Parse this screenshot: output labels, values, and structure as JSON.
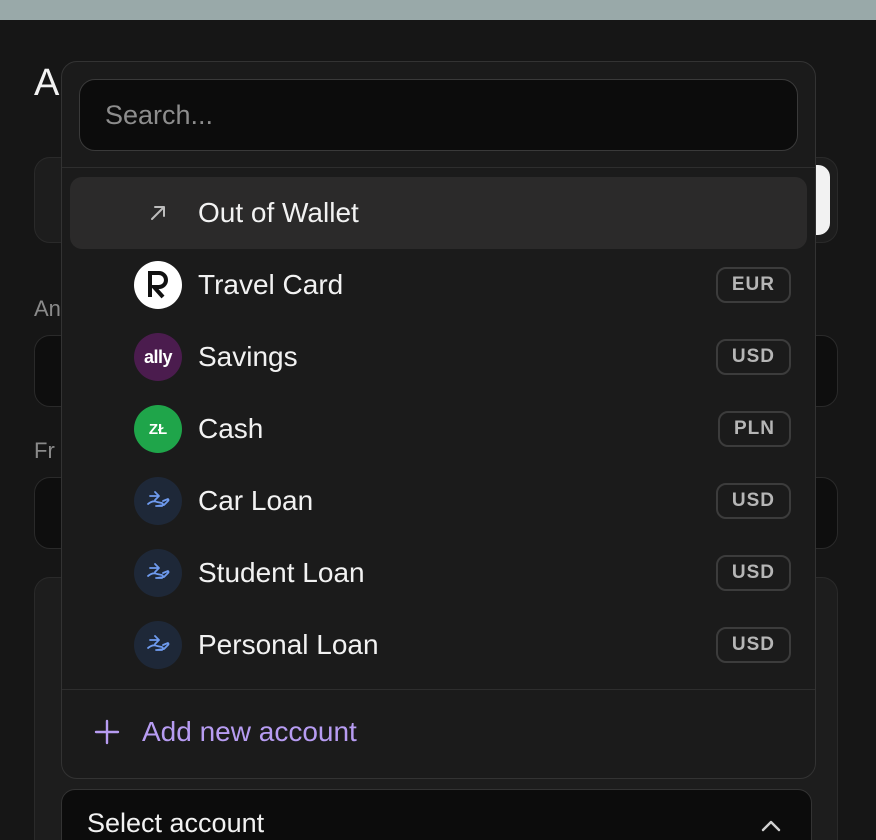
{
  "background": {
    "title_visible": "A",
    "label_1": "An",
    "label_2": "Fr"
  },
  "dropdown": {
    "search_placeholder": "Search...",
    "items": [
      {
        "label": "Out of Wallet",
        "currency": "",
        "icon": "arrow-up-right-icon",
        "active": true
      },
      {
        "label": "Travel Card",
        "currency": "EUR",
        "icon": "revolut-logo-icon"
      },
      {
        "label": "Savings",
        "currency": "USD",
        "icon": "ally-logo-icon",
        "icon_text": "ally"
      },
      {
        "label": "Cash",
        "currency": "PLN",
        "icon": "zloty-icon",
        "icon_text": "ZŁ"
      },
      {
        "label": "Car Loan",
        "currency": "USD",
        "icon": "loan-hand-icon"
      },
      {
        "label": "Student Loan",
        "currency": "USD",
        "icon": "loan-hand-icon"
      },
      {
        "label": "Personal Loan",
        "currency": "USD",
        "icon": "loan-hand-icon"
      }
    ],
    "add_label": "Add new account"
  },
  "select": {
    "label": "Select account"
  },
  "colors": {
    "accent": "#b79cf2",
    "ally": "#4b1c4e",
    "cash": "#1fa54a",
    "loan_bg": "#1e2838",
    "loan_fg": "#6f9bef"
  }
}
